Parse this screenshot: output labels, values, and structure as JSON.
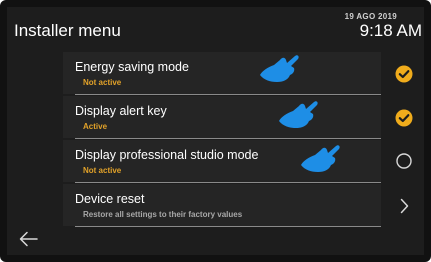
{
  "header": {
    "title": "Installer menu",
    "date": "19 AGO 2019",
    "time": "9:18 AM"
  },
  "menu": [
    {
      "label": "Energy saving mode",
      "status_text": "Not active",
      "state_icon": "check-circle-icon"
    },
    {
      "label": "Display alert key",
      "status_text": "Active",
      "state_icon": "check-circle-icon"
    },
    {
      "label": "Display professional studio mode",
      "status_text": "Not active",
      "state_icon": "empty-circle-icon"
    },
    {
      "label": "Device reset",
      "status_text": "Restore all settings to their factory values",
      "state_icon": "chevron-right-icon"
    }
  ],
  "footer": {
    "back_icon": "arrow-left-icon"
  },
  "colors": {
    "accent": "#f0ac1c",
    "status_text": "#e2a229",
    "background": "#1d1d1d",
    "pointer": "#1e8ee6"
  }
}
